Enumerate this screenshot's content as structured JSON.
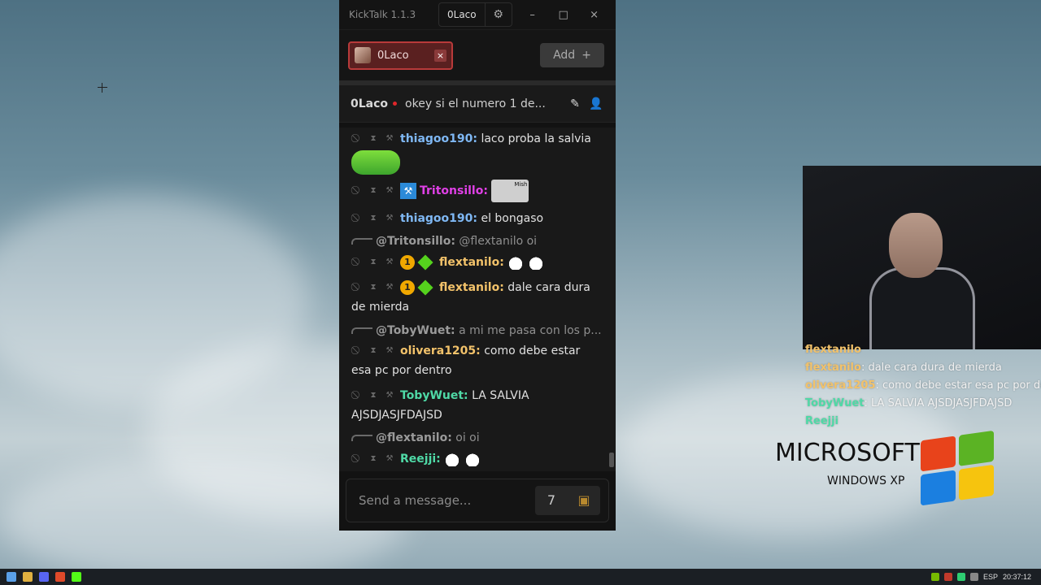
{
  "app": {
    "title": "KickTalk 1.1.3",
    "user": "0Laco",
    "colors": {
      "accent_tab": "#b83a3a",
      "bg": "#121212"
    }
  },
  "window_controls": {
    "minimize": "–",
    "maximize": "□",
    "close": "×"
  },
  "tabs": {
    "channel": "0Laco",
    "close": "×",
    "add_label": "Add",
    "add_icon": "+"
  },
  "channel": {
    "name": "0Laco",
    "topic": "okey si el numero 1 de..."
  },
  "messages": [
    {
      "user": "thiagoo190:",
      "text": "laco proba la salvia",
      "color": "#7fb8f4"
    },
    {
      "user": "Tritonsillo:",
      "text": "",
      "color": "#e040e6",
      "emote_text": "Mish"
    },
    {
      "user": "thiagoo190:",
      "text": "el bongaso",
      "color": "#7fb8f4"
    },
    {
      "reply": "@Tritonsillo:",
      "reply_text": "@flextanilo oi"
    },
    {
      "user": "flextanilo:",
      "text": "",
      "color": "#f2c26a"
    },
    {
      "user": "flextanilo:",
      "text": "dale cara dura de mierda",
      "color": "#f2c26a"
    },
    {
      "reply": "@TobyWuet:",
      "reply_text": "a mi me pasa con los p..."
    },
    {
      "user": "olivera1205:",
      "text": "como debe estar esa pc por dentro",
      "color": "#f2c26a"
    },
    {
      "user": "TobyWuet:",
      "text": "LA SALVIA AJSDJASJFDAJSD",
      "color": "#4fd9a6"
    },
    {
      "reply": "@flextanilo:",
      "reply_text": "oi oi"
    },
    {
      "user": "Reejji:",
      "text": "",
      "color": "#4fd9a6"
    }
  ],
  "badge_sub_label": "1",
  "composer": {
    "placeholder": "Send a message..."
  },
  "overlay": [
    {
      "user": "flextanilo",
      "text": ""
    },
    {
      "user": "flextanilo",
      "text": "dale cara dura de mierda"
    },
    {
      "user": "olivera1205",
      "text": ": como debe estar esa pc por dentro"
    },
    {
      "user": "TobyWuet",
      "text": ": LA SALVIA AJSDJASJFDAJSD"
    },
    {
      "user": "Reejji",
      "text": ""
    }
  ],
  "branding": {
    "line1": "MICROSOFT",
    "line2": "WINDOWS XP"
  },
  "taskbar": {
    "lang": "ESP",
    "time": "20:37:12"
  }
}
